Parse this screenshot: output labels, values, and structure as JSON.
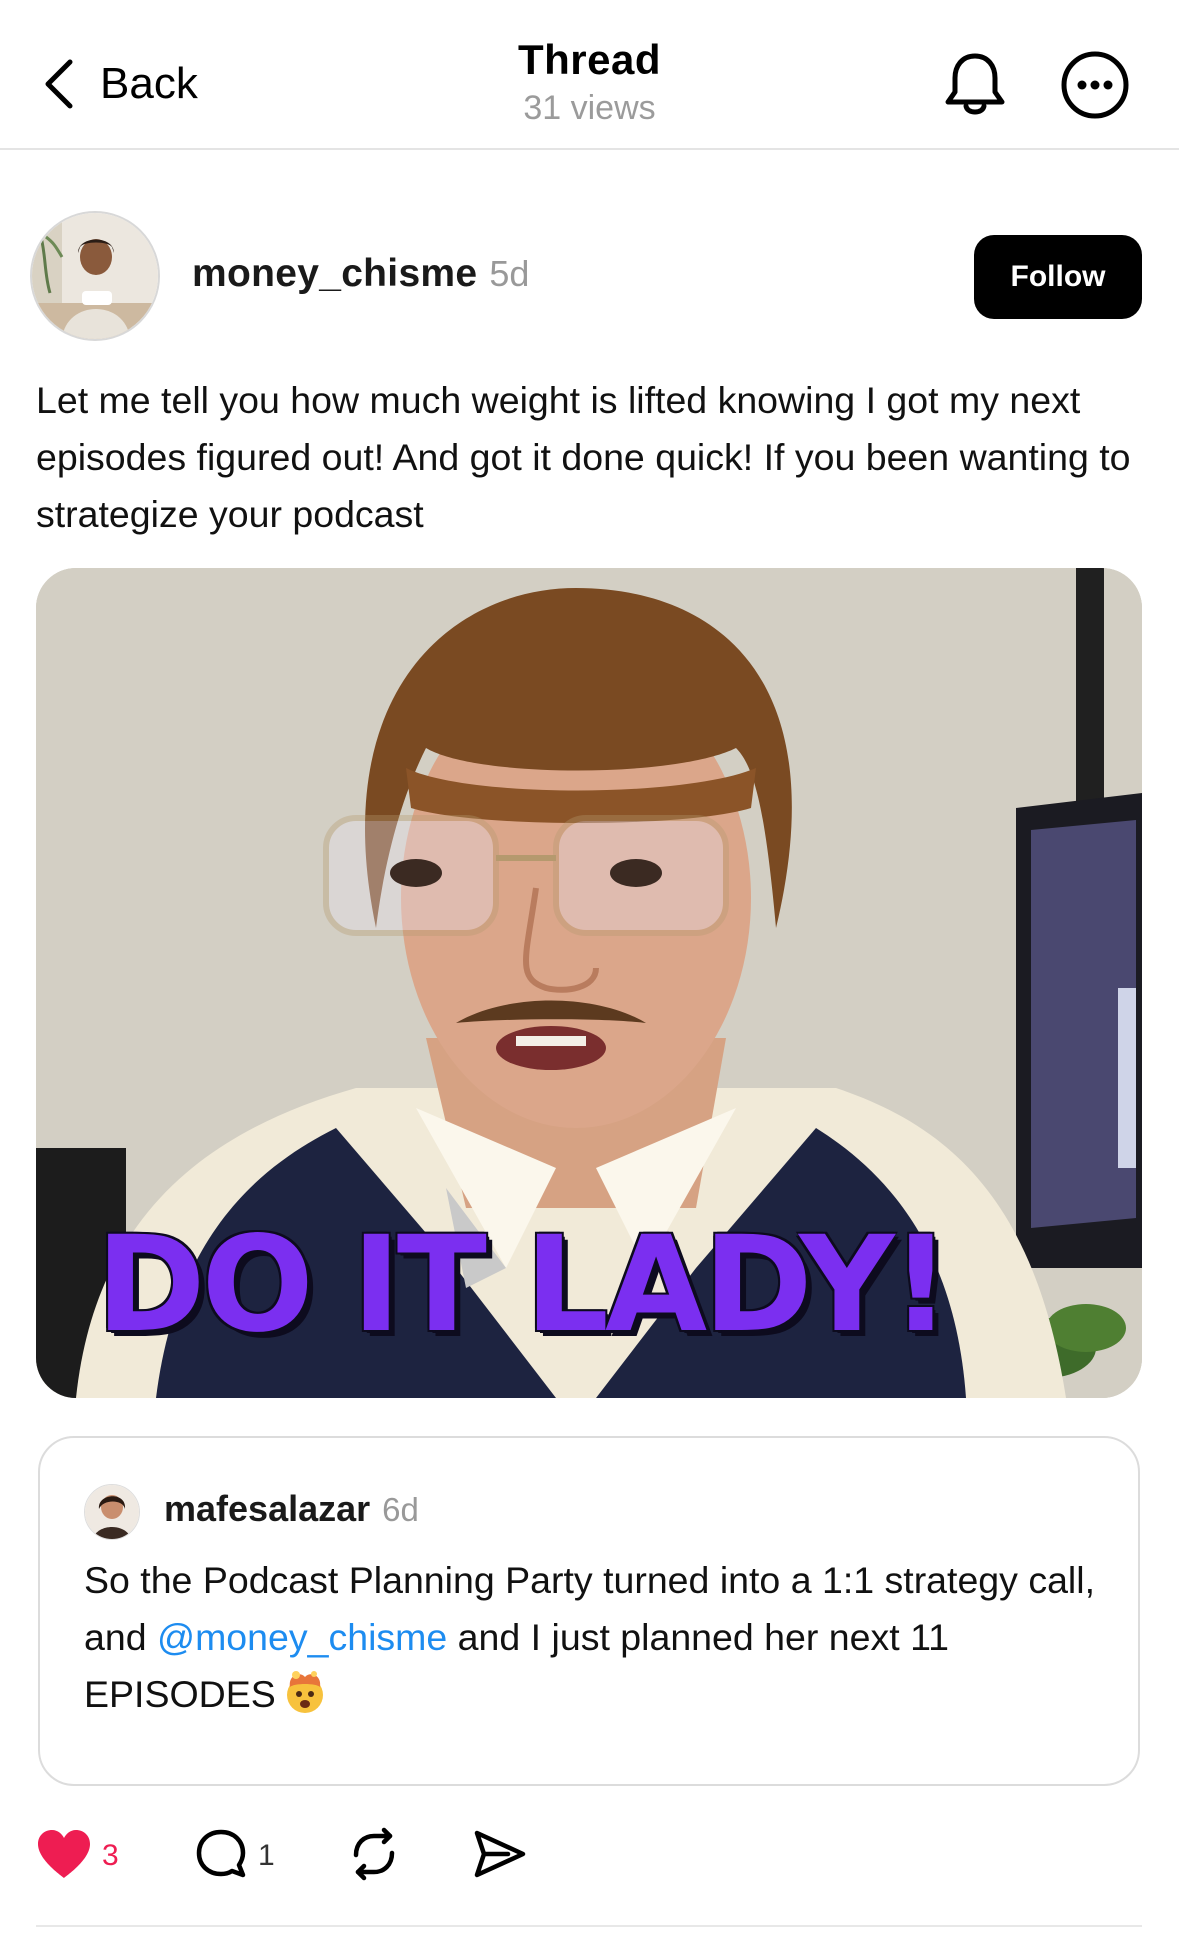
{
  "header": {
    "back_label": "Back",
    "title": "Thread",
    "views": "31 views",
    "icons": {
      "back": "chevron-left-icon",
      "notifications": "bell-icon",
      "more": "more-horizontal-icon"
    }
  },
  "post": {
    "username": "money_chisme",
    "timestamp": "5d",
    "follow_label": "Follow",
    "text": "Let me tell you how much weight is lifted knowing I got my next episodes figured out! And got it done quick! If you been wanting to strategize your podcast",
    "media": {
      "type": "gif",
      "caption": "DO IT LADY!"
    },
    "quoted": {
      "username": "mafesalazar",
      "timestamp": "6d",
      "text_before": "So the Podcast Planning Party turned into a 1:1 strategy call, and ",
      "mention": "@money_chisme",
      "text_after": " and I just planned her next 11 EPISODES",
      "emoji": "exploding-head-emoji"
    },
    "actions": {
      "likes": "3",
      "replies": "1",
      "liked": true
    }
  },
  "colors": {
    "accent_link": "#1d8cf0",
    "like": "#ee1d52",
    "caption": "#7b2ff0",
    "follow_bg": "#000000",
    "muted_text": "#999999"
  }
}
